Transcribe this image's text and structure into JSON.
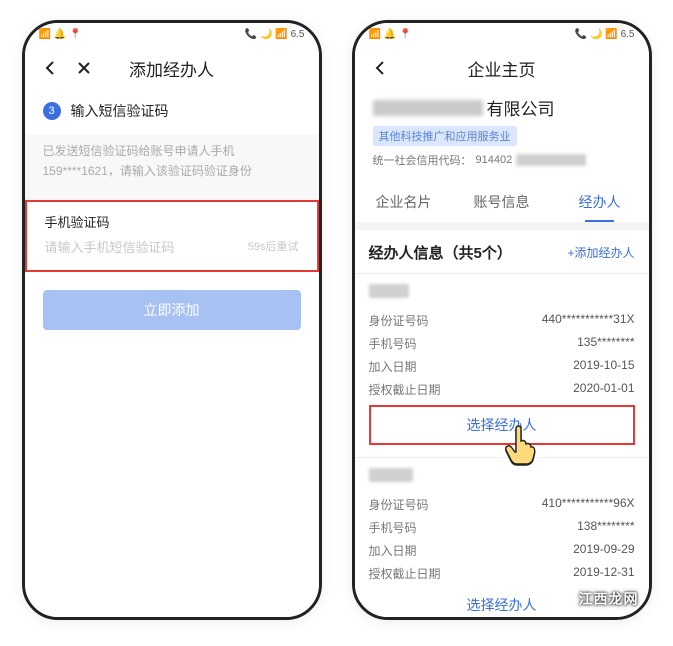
{
  "left": {
    "status_left": "📶 🔔 📍",
    "status_right": "📞 🌙 📶 6.5",
    "nav_title": "添加经办人",
    "step_num": "3",
    "step_label": "输入短信验证码",
    "hint": "已发送短信验证码给账号申请人手机159****1621，请输入该验证码验证身份",
    "input_label": "手机验证码",
    "input_placeholder": "请输入手机短信验证码",
    "retry_text": "59s后重试",
    "submit_btn": "立即添加"
  },
  "right": {
    "status_left": "📶 🔔 📍",
    "status_right": "📞 🌙 📶 6.5",
    "nav_title": "企业主页",
    "company_name_suffix": "有限公司",
    "tag": "其他科技推广和应用服务业",
    "credit_label": "统一社会信用代码：",
    "credit_value_prefix": "914402",
    "tabs": [
      "企业名片",
      "账号信息",
      "经办人"
    ],
    "section_title": "经办人信息（共5个）",
    "add_link": "+添加经办人",
    "select_btn": "选择经办人",
    "persons": [
      {
        "fields": [
          {
            "k": "身份证号码",
            "v": "440***********31X"
          },
          {
            "k": "手机号码",
            "v": "135********"
          },
          {
            "k": "加入日期",
            "v": "2019-10-15"
          },
          {
            "k": "授权截止日期",
            "v": "2020-01-01"
          }
        ]
      },
      {
        "fields": [
          {
            "k": "身份证号码",
            "v": "410***********96X"
          },
          {
            "k": "手机号码",
            "v": "138********"
          },
          {
            "k": "加入日期",
            "v": "2019-09-29"
          },
          {
            "k": "授权截止日期",
            "v": "2019-12-31"
          }
        ]
      }
    ]
  },
  "watermark": "江西龙网"
}
